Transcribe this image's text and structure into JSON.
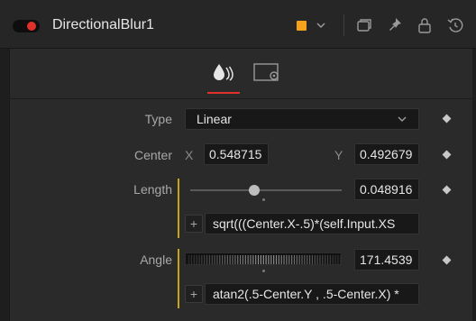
{
  "header": {
    "title": "DirectionalBlur1",
    "tool_color": "#f4a11c",
    "toggle_color": "#e0302a"
  },
  "tabs": [
    {
      "icon": "blur-drops-icon",
      "active": true
    },
    {
      "icon": "settings-tab-icon",
      "active": false
    }
  ],
  "controls": {
    "type": {
      "label": "Type",
      "value": "Linear"
    },
    "center": {
      "label": "Center",
      "x_label": "X",
      "x_value": "0.548715",
      "y_label": "Y",
      "y_value": "0.492679"
    },
    "length": {
      "label": "Length",
      "value": "0.048916",
      "slider_fraction": 0.42,
      "expression": "sqrt(((Center.X-.5)*(self.Input.XS"
    },
    "angle": {
      "label": "Angle",
      "value": "171.4539",
      "expression": "atan2(.5-Center.Y , .5-Center.X) *"
    }
  },
  "expression_button": "+"
}
